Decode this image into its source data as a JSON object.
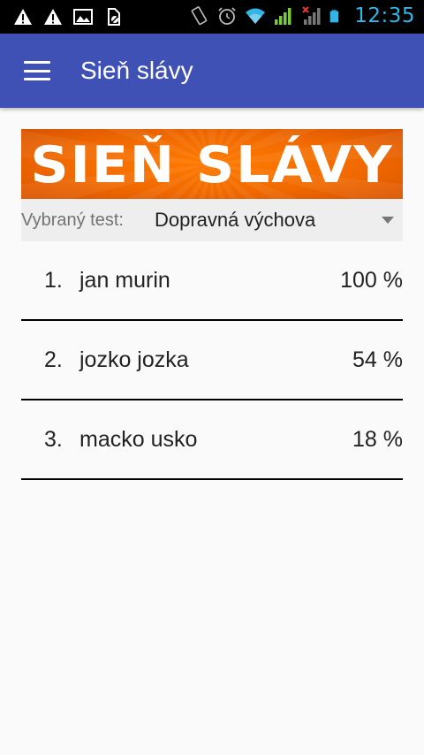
{
  "status_bar": {
    "time": "12:35",
    "icons": [
      "warning-icon",
      "warning-icon",
      "image-icon",
      "no-sim-icon",
      "vibrate-icon",
      "alarm-icon",
      "wifi-icon",
      "signal-icon",
      "signal-no-data-icon",
      "battery-icon"
    ]
  },
  "app_bar": {
    "title": "Sieň slávy",
    "menu_icon": "hamburger-menu-icon"
  },
  "banner": {
    "text": "Sieň slávy"
  },
  "test_selector": {
    "label": "Vybraný test:",
    "selected": "Dopravná výchova"
  },
  "leaderboard": [
    {
      "rank": "1.",
      "name": "jan murin",
      "score": "100 %"
    },
    {
      "rank": "2.",
      "name": "jozko jozka",
      "score": "54 %"
    },
    {
      "rank": "3.",
      "name": "macko usko",
      "score": "18 %"
    }
  ],
  "colors": {
    "app_bar": "#3f51b5",
    "banner": "#f16a00",
    "time": "#33b5e5",
    "signal_green": "#7ac943"
  }
}
